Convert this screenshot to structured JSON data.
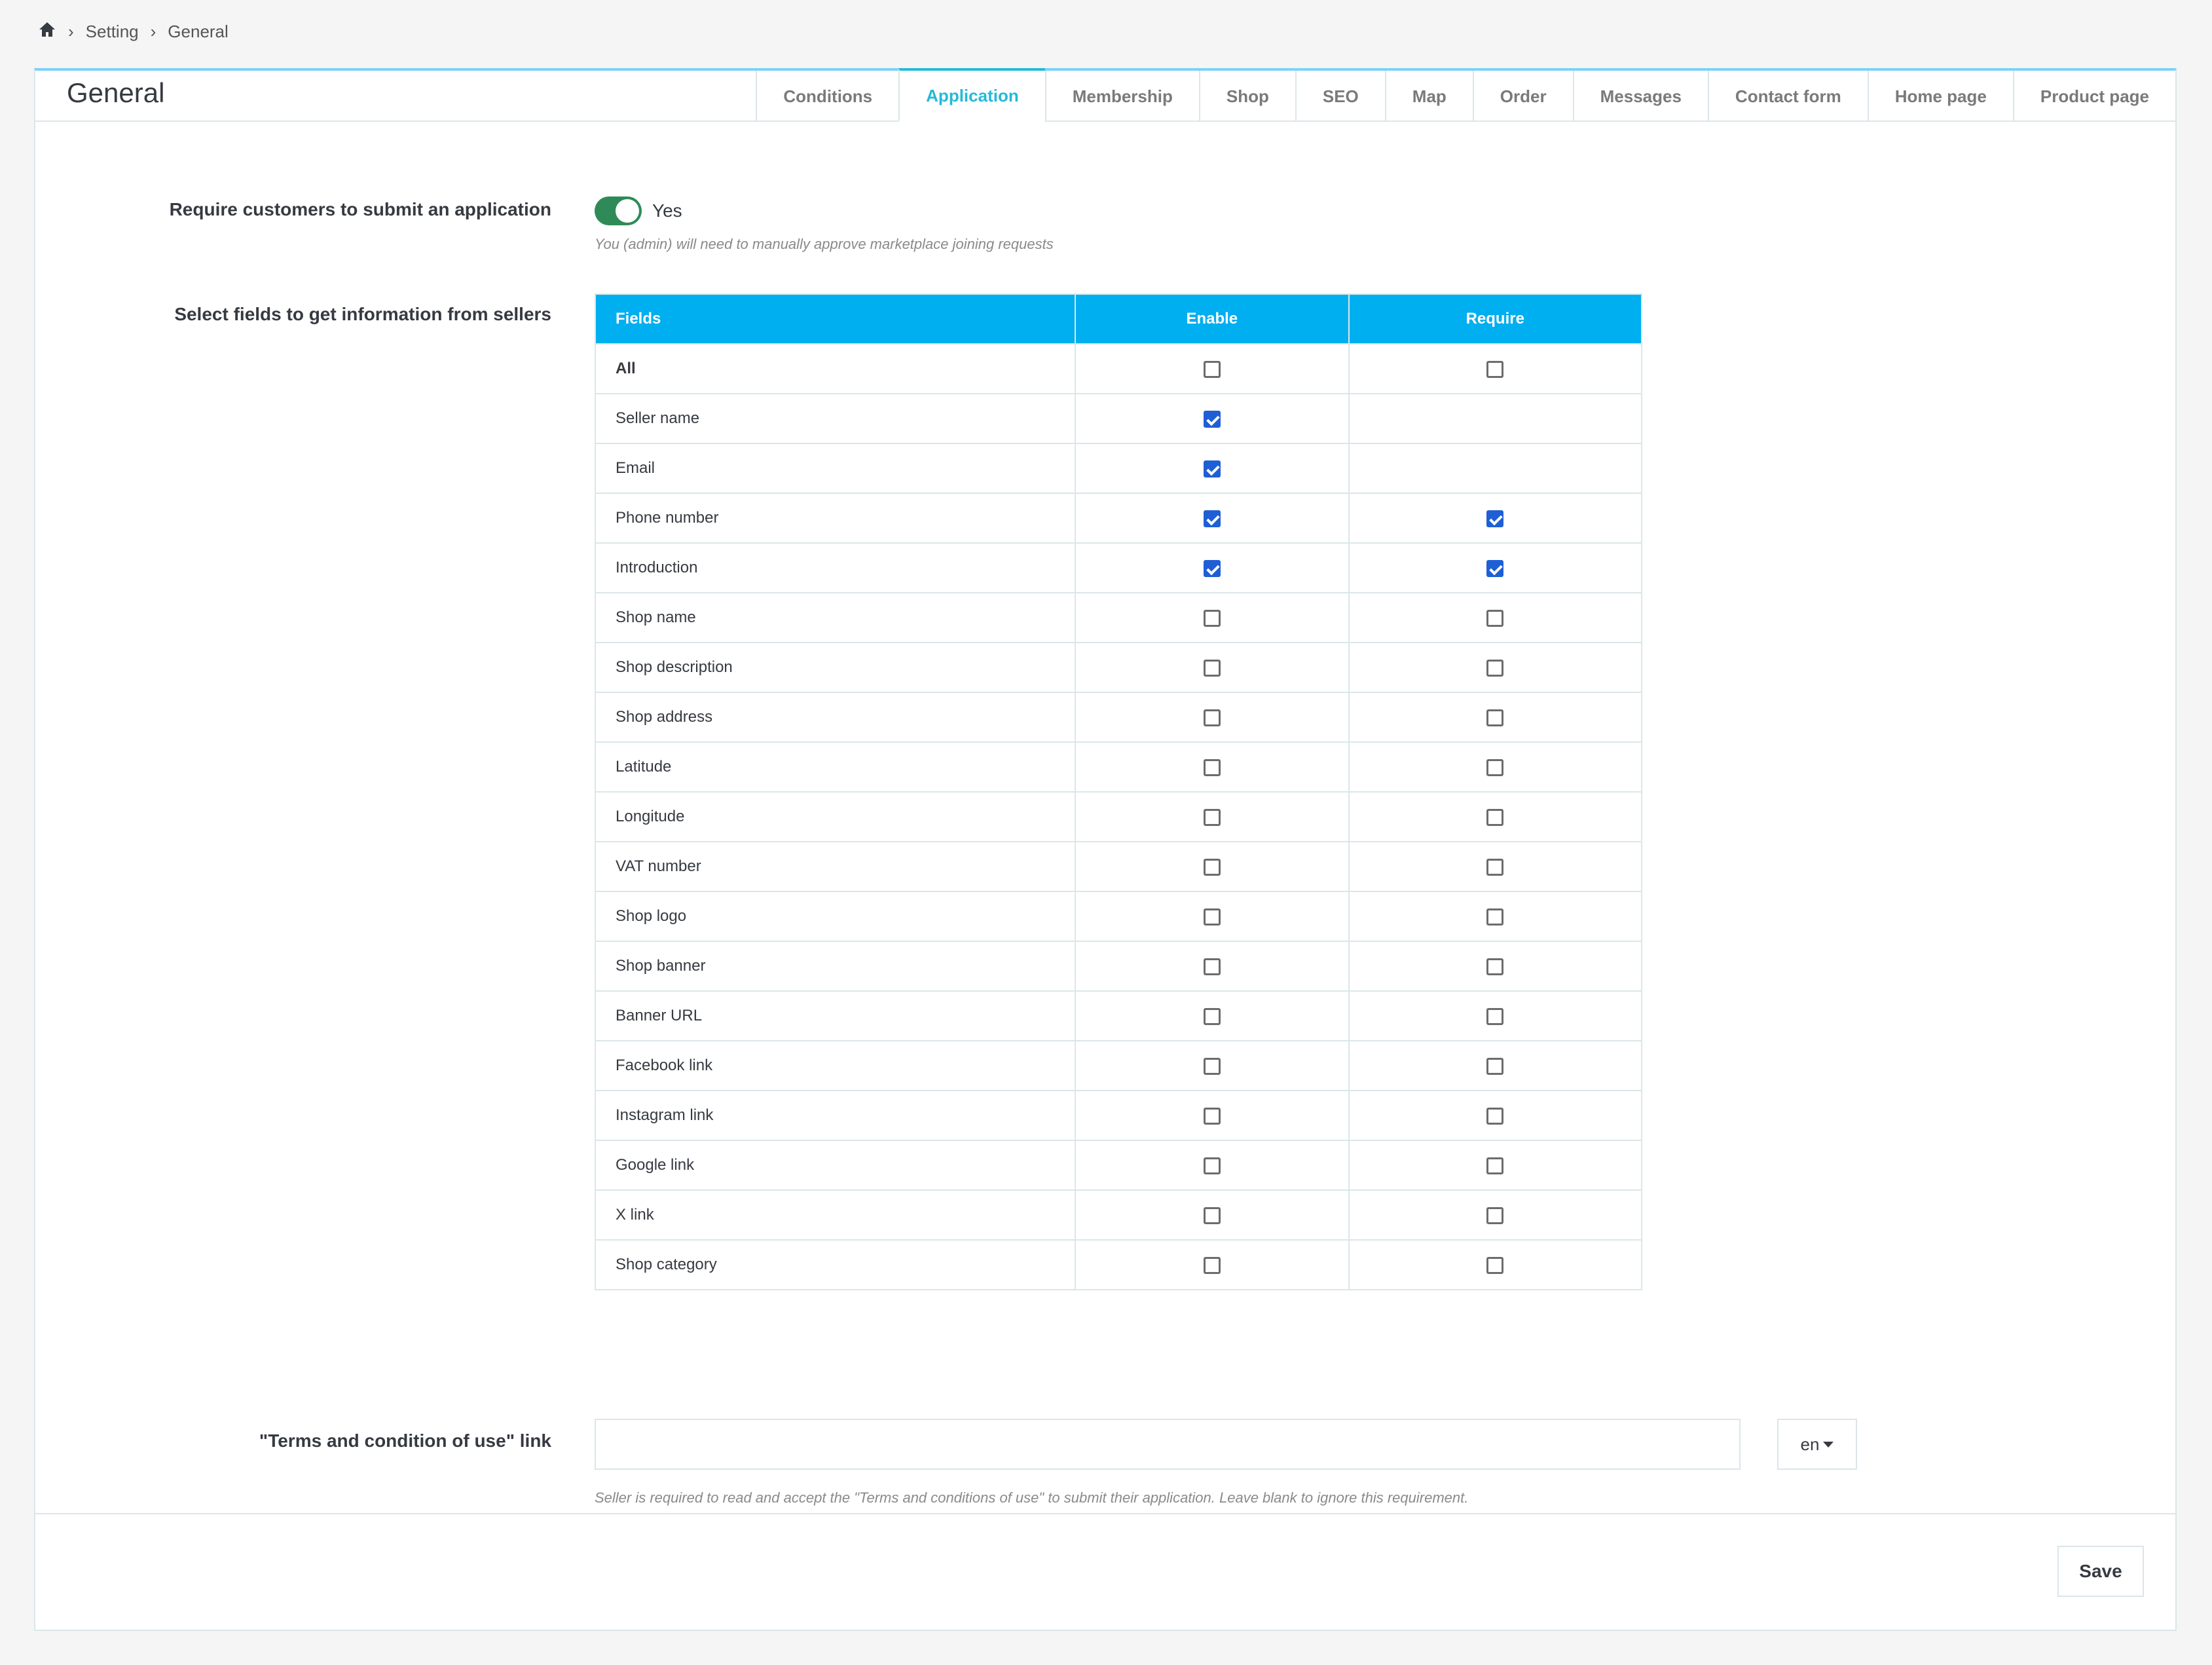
{
  "breadcrumb": {
    "home_icon": "home-icon",
    "items": [
      "Setting",
      "General"
    ]
  },
  "panel": {
    "title": "General"
  },
  "tabs": [
    {
      "label": "Conditions",
      "active": false
    },
    {
      "label": "Application",
      "active": true
    },
    {
      "label": "Membership",
      "active": false
    },
    {
      "label": "Shop",
      "active": false
    },
    {
      "label": "SEO",
      "active": false
    },
    {
      "label": "Map",
      "active": false
    },
    {
      "label": "Order",
      "active": false
    },
    {
      "label": "Messages",
      "active": false
    },
    {
      "label": "Contact form",
      "active": false
    },
    {
      "label": "Home page",
      "active": false
    },
    {
      "label": "Product page",
      "active": false
    }
  ],
  "require_application": {
    "label": "Require customers to submit an application",
    "toggle_value": "Yes",
    "help": "You (admin) will need to manually approve marketplace joining requests"
  },
  "fields_section": {
    "label": "Select fields to get information from sellers",
    "headers": [
      "Fields",
      "Enable",
      "Require"
    ],
    "rows": [
      {
        "name": "All",
        "enable": false,
        "require": false
      },
      {
        "name": "Seller name",
        "enable": true,
        "require": null
      },
      {
        "name": "Email",
        "enable": true,
        "require": null
      },
      {
        "name": "Phone number",
        "enable": true,
        "require": true
      },
      {
        "name": "Introduction",
        "enable": true,
        "require": true
      },
      {
        "name": "Shop name",
        "enable": false,
        "require": false
      },
      {
        "name": "Shop description",
        "enable": false,
        "require": false
      },
      {
        "name": "Shop address",
        "enable": false,
        "require": false
      },
      {
        "name": "Latitude",
        "enable": false,
        "require": false
      },
      {
        "name": "Longitude",
        "enable": false,
        "require": false
      },
      {
        "name": "VAT number",
        "enable": false,
        "require": false
      },
      {
        "name": "Shop logo",
        "enable": false,
        "require": false
      },
      {
        "name": "Shop banner",
        "enable": false,
        "require": false
      },
      {
        "name": "Banner URL",
        "enable": false,
        "require": false
      },
      {
        "name": "Facebook link",
        "enable": false,
        "require": false
      },
      {
        "name": "Instagram link",
        "enable": false,
        "require": false
      },
      {
        "name": "Google link",
        "enable": false,
        "require": false
      },
      {
        "name": "X link",
        "enable": false,
        "require": false
      },
      {
        "name": "Shop category",
        "enable": false,
        "require": false
      }
    ]
  },
  "terms": {
    "label": "\"Terms and condition of use\" link",
    "value": "",
    "language": "en",
    "help": "Seller is required to read and accept the \"Terms and conditions of use\" to submit their application. Leave blank to ignore this requirement."
  },
  "footer": {
    "save_label": "Save"
  },
  "colors": {
    "accent": "#25b9d7",
    "table_header": "#00aff0",
    "toggle_on": "#2e8b57",
    "checkbox_on": "#1f5fd6"
  }
}
